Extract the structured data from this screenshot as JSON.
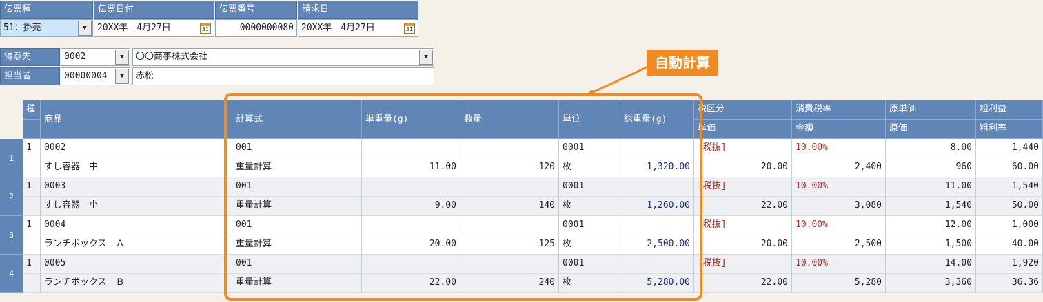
{
  "header": {
    "slip_type": {
      "label": "伝票種",
      "value": "51：掛売"
    },
    "slip_date": {
      "label": "伝票日付",
      "value": "20XX年　4月27日"
    },
    "slip_number": {
      "label": "伝票番号",
      "value": "0000000080"
    },
    "billing_date": {
      "label": "請求日",
      "value": "20XX年　4月27日"
    },
    "calendar_icon_text": "31"
  },
  "customer": {
    "label": "得意先",
    "code": "0002",
    "name": "〇〇商事株式会社"
  },
  "staff": {
    "label": "担当者",
    "code": "00000004",
    "name": "赤松"
  },
  "callout": {
    "label": "自動計算",
    "color": "#ef8b22"
  },
  "grid": {
    "headers": {
      "kind": "種",
      "product": "商品",
      "formula": "計算式",
      "unit_weight": "単重量(g)",
      "quantity": "数量",
      "unit": "単位",
      "total_weight": "総重量(g)",
      "tax_class": "税区分",
      "unit_price": "単価",
      "tax_rate": "消費税率",
      "amount": "金額",
      "cost_unit": "原単価",
      "cost": "原価",
      "gross_profit": "粗利益",
      "gross_rate": "粗利率"
    },
    "rows": [
      {
        "no": "1",
        "kind": "1",
        "code": "0002",
        "name": "すし容器　中",
        "formula_code": "001",
        "formula_name": "重量計算",
        "unit_weight": "11.00",
        "quantity": "120",
        "unit_code": "0001",
        "unit_name": "枚",
        "total_weight": "1,320.00",
        "tax_class": "[税抜]",
        "unit_price": "20.00",
        "tax_rate": "10.00%",
        "amount": "2,400",
        "cost_unit": "8.00",
        "cost": "960",
        "gross_profit": "1,440",
        "gross_rate": "60.00"
      },
      {
        "no": "2",
        "kind": "1",
        "code": "0003",
        "name": "すし容器　小",
        "formula_code": "001",
        "formula_name": "重量計算",
        "unit_weight": "9.00",
        "quantity": "140",
        "unit_code": "0001",
        "unit_name": "枚",
        "total_weight": "1,260.00",
        "tax_class": "[税抜]",
        "unit_price": "22.00",
        "tax_rate": "10.00%",
        "amount": "3,080",
        "cost_unit": "11.00",
        "cost": "1,540",
        "gross_profit": "1,540",
        "gross_rate": "50.00"
      },
      {
        "no": "3",
        "kind": "1",
        "code": "0004",
        "name": "ランチボックス　Ａ",
        "formula_code": "001",
        "formula_name": "重量計算",
        "unit_weight": "20.00",
        "quantity": "125",
        "unit_code": "0001",
        "unit_name": "枚",
        "total_weight": "2,500.00",
        "tax_class": "[税抜]",
        "unit_price": "20.00",
        "tax_rate": "10.00%",
        "amount": "2,500",
        "cost_unit": "12.00",
        "cost": "1,500",
        "gross_profit": "1,000",
        "gross_rate": "40.00"
      },
      {
        "no": "4",
        "kind": "1",
        "code": "0005",
        "name": "ランチボックス　Ｂ",
        "formula_code": "001",
        "formula_name": "重量計算",
        "unit_weight": "22.00",
        "quantity": "240",
        "unit_code": "0001",
        "unit_name": "枚",
        "total_weight": "5,280.00",
        "tax_class": "[税抜]",
        "unit_price": "22.00",
        "tax_rate": "10.00%",
        "amount": "5,280",
        "cost_unit": "14.00",
        "cost": "3,360",
        "gross_profit": "1,920",
        "gross_rate": "36.36"
      }
    ]
  }
}
